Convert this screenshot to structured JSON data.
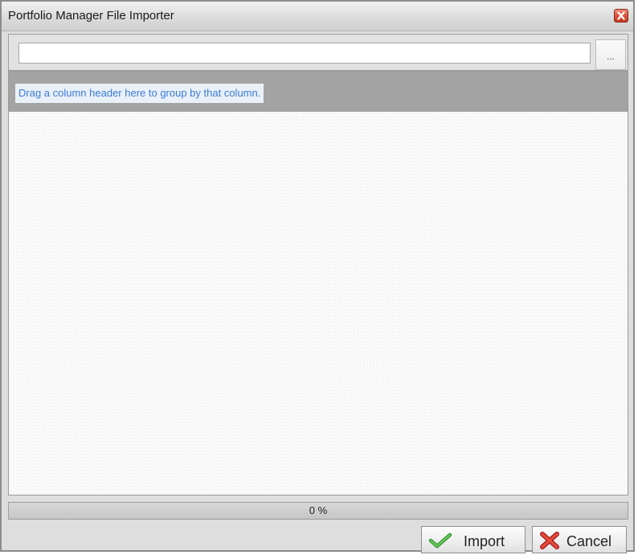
{
  "window": {
    "title": "Portfolio Manager File Importer",
    "close_icon": "close-icon"
  },
  "file_path": {
    "value": "",
    "placeholder": "",
    "browse_label": "..."
  },
  "grid": {
    "group_hint": "Drag a column header here to group by that column.",
    "rows": []
  },
  "progress": {
    "value": 0,
    "label": "0 %",
    "fill_color": "#5aa7e0"
  },
  "buttons": {
    "import_label": "Import",
    "import_icon": "checkmark-icon",
    "cancel_label": "Cancel",
    "cancel_icon": "red-x-icon"
  }
}
